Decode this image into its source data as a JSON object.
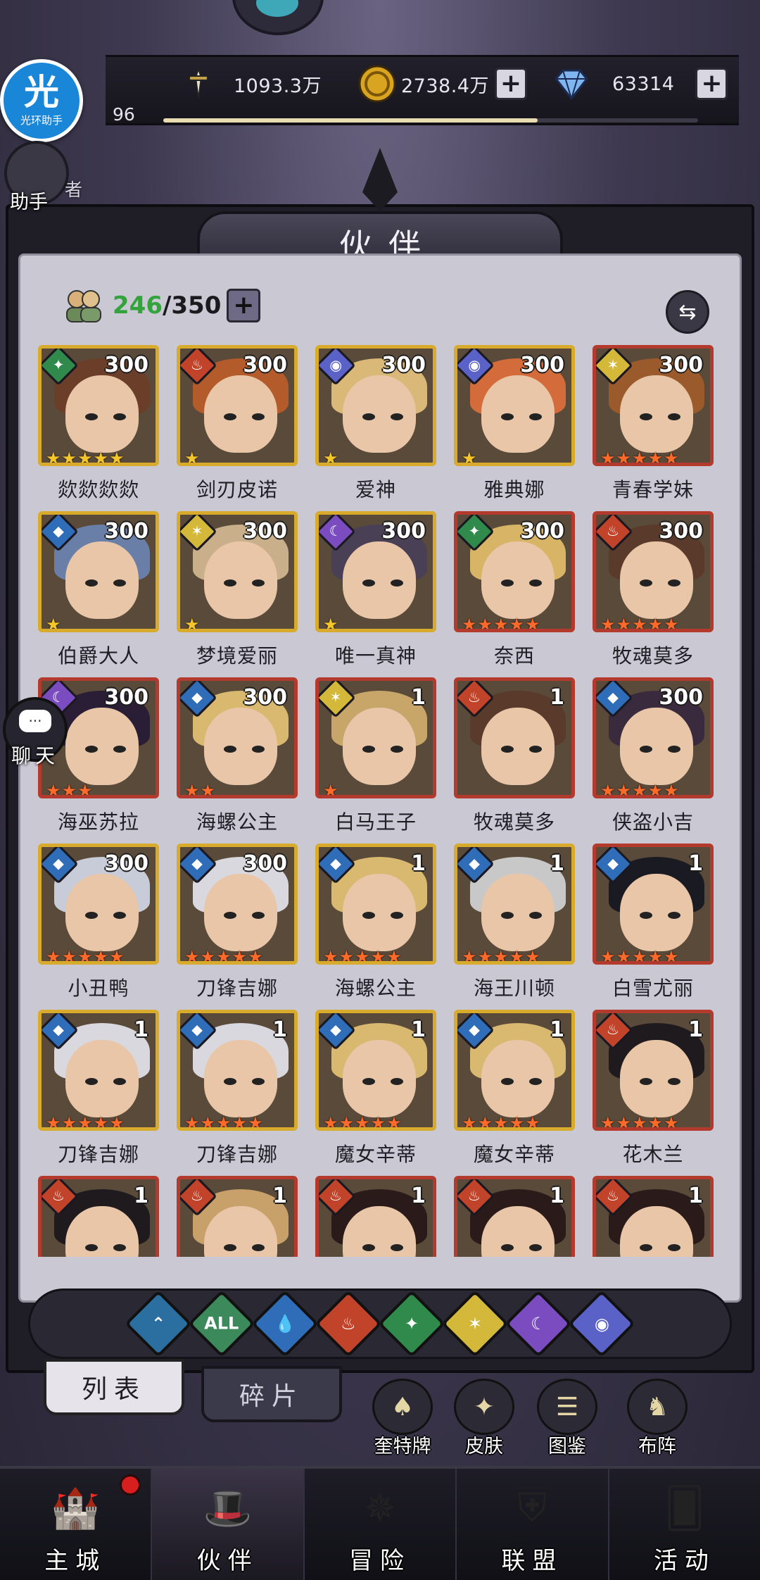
{
  "resources": {
    "power": {
      "icon": "sword-icon",
      "value": "1093.3万"
    },
    "gold": {
      "icon": "gold-coin-icon",
      "value": "2738.4万"
    },
    "diamond": {
      "icon": "diamond-icon",
      "value": "63314"
    },
    "plus": "+"
  },
  "player": {
    "level": "96",
    "exp_fraction": 0.7
  },
  "overlay": {
    "gh_char": "光",
    "gh_text": "光环助手",
    "helper_label": "助手",
    "rank_label": "者",
    "chat_label": "聊天",
    "chat_glyph": "···"
  },
  "panel": {
    "title": "伙伴",
    "count_current": "246",
    "count_sep_total": "/350",
    "sort_glyph": "⇆"
  },
  "element_colors": {
    "earth": "#2f8a4c",
    "fire": "#c0432a",
    "water": "#2f6db8",
    "light": "#d4b83a",
    "dark": "#7a4cc0",
    "cosmic": "#5a62c8"
  },
  "element_glyphs": {
    "earth": "✦",
    "fire": "♨",
    "water": "◆",
    "light": "✶",
    "dark": "☾",
    "cosmic": "◉"
  },
  "heroes": [
    {
      "name": "欻欻欻欻",
      "level": "300",
      "element": "earth",
      "stars": 5,
      "star_color": "gold",
      "rarity": "gold",
      "hair": "#6b3e2a"
    },
    {
      "name": "剑刃皮诺",
      "level": "300",
      "element": "fire",
      "stars": 1,
      "star_color": "gold",
      "rarity": "gold",
      "hair": "#b35b2a"
    },
    {
      "name": "爱神",
      "level": "300",
      "element": "cosmic",
      "stars": 1,
      "star_color": "gold",
      "rarity": "gold",
      "hair": "#d9b878"
    },
    {
      "name": "雅典娜",
      "level": "300",
      "element": "cosmic",
      "stars": 1,
      "star_color": "gold",
      "rarity": "gold",
      "hair": "#d36b3a"
    },
    {
      "name": "青春学妹",
      "level": "300",
      "element": "light",
      "stars": 5,
      "star_color": "red",
      "rarity": "red",
      "hair": "#9a5a2c"
    },
    {
      "name": "伯爵大人",
      "level": "300",
      "element": "water",
      "stars": 1,
      "star_color": "gold",
      "rarity": "gold",
      "hair": "#6a7fa8"
    },
    {
      "name": "梦境爱丽",
      "level": "300",
      "element": "light",
      "stars": 1,
      "star_color": "gold",
      "rarity": "gold",
      "hair": "#c9b08a"
    },
    {
      "name": "唯一真神",
      "level": "300",
      "element": "dark",
      "stars": 1,
      "star_color": "gold",
      "rarity": "gold",
      "hair": "#4a4056"
    },
    {
      "name": "奈西",
      "level": "300",
      "element": "earth",
      "stars": 5,
      "star_color": "red",
      "rarity": "red",
      "hair": "#d8b466"
    },
    {
      "name": "牧魂莫多",
      "level": "300",
      "element": "fire",
      "stars": 5,
      "star_color": "red",
      "rarity": "red",
      "hair": "#5a3a2a"
    },
    {
      "name": "海巫苏拉",
      "level": "300",
      "element": "dark",
      "stars": 3,
      "star_color": "red",
      "rarity": "red",
      "hair": "#2a1e36"
    },
    {
      "name": "海螺公主",
      "level": "300",
      "element": "water",
      "stars": 2,
      "star_color": "red",
      "rarity": "red",
      "hair": "#d9b870"
    },
    {
      "name": "白马王子",
      "level": "1",
      "element": "light",
      "stars": 1,
      "star_color": "red",
      "rarity": "red",
      "hair": "#c8a66a"
    },
    {
      "name": "牧魂莫多",
      "level": "1",
      "element": "fire",
      "stars": 0,
      "star_color": "red",
      "rarity": "red",
      "hair": "#5a3a2a"
    },
    {
      "name": "侠盗小吉",
      "level": "300",
      "element": "water",
      "stars": 5,
      "star_color": "red",
      "rarity": "red",
      "hair": "#3a2a3e"
    },
    {
      "name": "小丑鸭",
      "level": "300",
      "element": "water",
      "stars": 5,
      "star_color": "red",
      "rarity": "gold",
      "hair": "#c8cbd8"
    },
    {
      "name": "刀锋吉娜",
      "level": "300",
      "element": "water",
      "stars": 5,
      "star_color": "red",
      "rarity": "gold",
      "hair": "#d8d8de"
    },
    {
      "name": "海螺公主",
      "level": "1",
      "element": "water",
      "stars": 5,
      "star_color": "red",
      "rarity": "gold",
      "hair": "#d9b870"
    },
    {
      "name": "海王川顿",
      "level": "1",
      "element": "water",
      "stars": 5,
      "star_color": "red",
      "rarity": "gold",
      "hair": "#c8c8c8"
    },
    {
      "name": "白雪尤丽",
      "level": "1",
      "element": "water",
      "stars": 5,
      "star_color": "red",
      "rarity": "red",
      "hair": "#1a1a22"
    },
    {
      "name": "刀锋吉娜",
      "level": "1",
      "element": "water",
      "stars": 5,
      "star_color": "red",
      "rarity": "gold",
      "hair": "#d8d8de"
    },
    {
      "name": "刀锋吉娜",
      "level": "1",
      "element": "water",
      "stars": 5,
      "star_color": "red",
      "rarity": "gold",
      "hair": "#d8d8de"
    },
    {
      "name": "魔女辛蒂",
      "level": "1",
      "element": "water",
      "stars": 5,
      "star_color": "red",
      "rarity": "gold",
      "hair": "#d9b870"
    },
    {
      "name": "魔女辛蒂",
      "level": "1",
      "element": "water",
      "stars": 5,
      "star_color": "red",
      "rarity": "gold",
      "hair": "#d9b870"
    },
    {
      "name": "花木兰",
      "level": "1",
      "element": "fire",
      "stars": 5,
      "star_color": "red",
      "rarity": "red",
      "hair": "#1e1a1e"
    },
    {
      "name": "",
      "level": "1",
      "element": "fire",
      "stars": 0,
      "star_color": "red",
      "rarity": "red",
      "hair": "#1e1a1e"
    },
    {
      "name": "",
      "level": "1",
      "element": "fire",
      "stars": 0,
      "star_color": "red",
      "rarity": "red",
      "hair": "#c8a06a"
    },
    {
      "name": "",
      "level": "1",
      "element": "fire",
      "stars": 0,
      "star_color": "red",
      "rarity": "red",
      "hair": "#2a1a1a"
    },
    {
      "name": "",
      "level": "1",
      "element": "fire",
      "stars": 0,
      "star_color": "red",
      "rarity": "red",
      "hair": "#2a1a1a"
    },
    {
      "name": "",
      "level": "1",
      "element": "fire",
      "stars": 0,
      "star_color": "red",
      "rarity": "red",
      "hair": "#2a1a1a"
    }
  ],
  "filters": [
    {
      "key": "top",
      "glyph": "⌃",
      "color": "#2a6fa0"
    },
    {
      "key": "all",
      "glyph": "ALL",
      "color": "#3c8a5c"
    },
    {
      "key": "water",
      "glyph": "💧",
      "color": "#2f6db8"
    },
    {
      "key": "fire",
      "glyph": "♨",
      "color": "#c0432a"
    },
    {
      "key": "earth",
      "glyph": "✦",
      "color": "#2f8a4c"
    },
    {
      "key": "light",
      "glyph": "✶",
      "color": "#d4b83a"
    },
    {
      "key": "dark",
      "glyph": "☾",
      "color": "#7a4cc0"
    },
    {
      "key": "cosmic",
      "glyph": "◉",
      "color": "#5a62c8"
    }
  ],
  "tabs": {
    "list": "列表",
    "fragments": "碎片"
  },
  "shortcuts": [
    {
      "label": "奎特牌",
      "icon": "card-deck-icon",
      "glyph": "♠"
    },
    {
      "label": "皮肤",
      "icon": "skin-icon",
      "glyph": "✦"
    },
    {
      "label": "图鉴",
      "icon": "codex-icon",
      "glyph": "☰"
    },
    {
      "label": "布阵",
      "icon": "formation-icon",
      "glyph": "♞"
    }
  ],
  "nav": [
    {
      "label": "主城",
      "icon": "castle-icon",
      "glyph": "🏰",
      "active": false,
      "badge": true
    },
    {
      "label": "伙伴",
      "icon": "wizard-hat-icon",
      "glyph": "🎩",
      "active": true,
      "badge": false
    },
    {
      "label": "冒险",
      "icon": "compass-icon",
      "glyph": "✵",
      "active": false,
      "badge": false
    },
    {
      "label": "联盟",
      "icon": "shield-icon",
      "glyph": "⛨",
      "active": false,
      "badge": false
    },
    {
      "label": "活动",
      "icon": "cards-icon",
      "glyph": "🂠",
      "active": false,
      "badge": false
    }
  ]
}
